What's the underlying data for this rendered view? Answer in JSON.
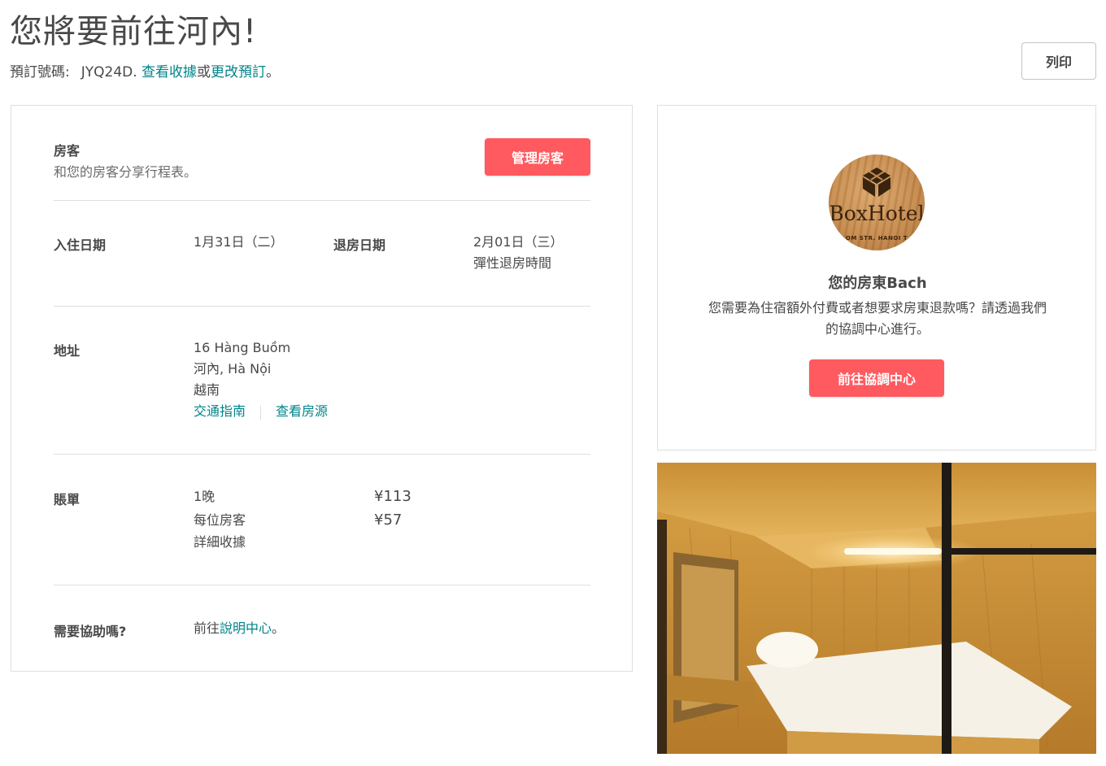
{
  "header": {
    "title": "您將要前往河內!",
    "confirmation_label": "預訂號碼:",
    "confirmation_code": "JYQ24D.",
    "view_receipt_link": "查看收據",
    "or_text": "或",
    "change_reservation_link": "更改預訂",
    "period": "。",
    "print_button": "列印"
  },
  "guests": {
    "title": "房客",
    "subtitle": "和您的房客分享行程表。",
    "manage_button": "管理房客"
  },
  "dates": {
    "checkin_label": "入住日期",
    "checkin_value": "1月31日（二）",
    "checkout_label": "退房日期",
    "checkout_value": "2月01日（三）",
    "checkout_note": "彈性退房時間"
  },
  "address": {
    "label": "地址",
    "line1": "16 Hàng Buồm",
    "line2": "河內, Hà Nội",
    "line3": "越南",
    "directions_link": "交通指南",
    "view_listing_link": "查看房源"
  },
  "billing": {
    "label": "賬單",
    "rows": [
      {
        "item": "1晚",
        "amount": "¥113"
      },
      {
        "item": "每位房客",
        "amount": "¥57"
      }
    ],
    "detailed_receipt_link": "詳細收據"
  },
  "help": {
    "label": "需要協助嗎?",
    "prefix": "前往",
    "help_center_link": "說明中心",
    "suffix": "。"
  },
  "host": {
    "avatar_brand": "BoxHotel",
    "avatar_sub": "OM STR. HANOI T",
    "name": "您的房東Bach",
    "description": "您需要為住宿額外付費或者想要求房東退款嗎？請透過我們的協調中心進行。",
    "resolution_button": "前往協調中心"
  },
  "colors": {
    "accent": "#ff5a5f",
    "link": "#00848a",
    "text": "#484848",
    "border": "#dce0e0"
  }
}
